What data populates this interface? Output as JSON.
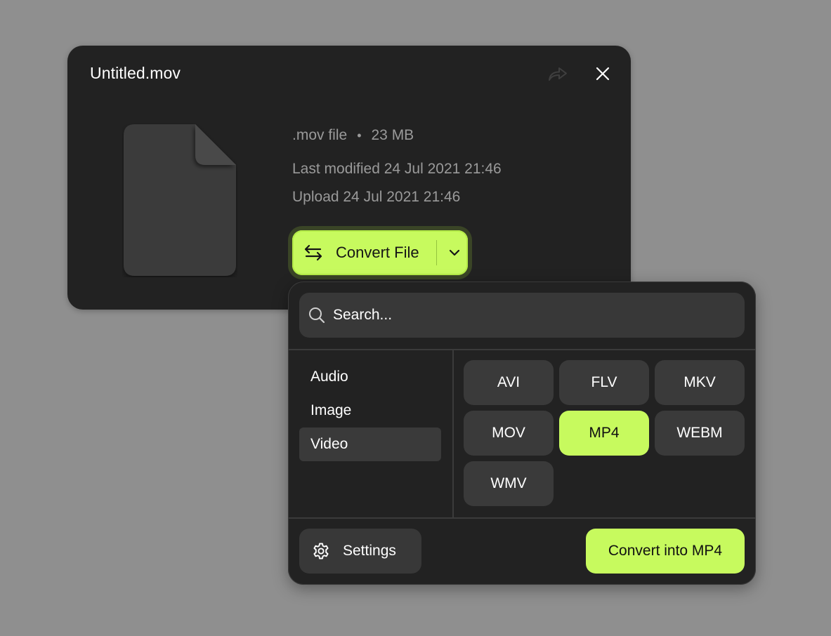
{
  "colors": {
    "background": "#8f8f8f",
    "card": "#222222",
    "accent": "#c7fa5e",
    "muted_text": "#9a9a9a",
    "chip": "#3a3a3a"
  },
  "file_card": {
    "title": "Untitled.mov",
    "share_icon": "share-forward-icon",
    "close_icon": "close-icon",
    "file_icon": "document-icon",
    "file_type": ".mov file",
    "separator": "•",
    "file_size": "23 MB",
    "last_modified": "Last modified 24 Jul 2021 21:46",
    "uploaded": "Upload 24 Jul 2021 21:46",
    "convert_button": {
      "label": "Convert File",
      "icon": "swap-arrows-icon",
      "dropdown_icon": "chevron-down-icon"
    }
  },
  "convert_panel": {
    "search": {
      "placeholder": "Search...",
      "value": "",
      "icon": "search-icon"
    },
    "categories": [
      {
        "label": "Audio",
        "active": false
      },
      {
        "label": "Image",
        "active": false
      },
      {
        "label": "Video",
        "active": true
      }
    ],
    "formats": [
      {
        "label": "AVI",
        "selected": false
      },
      {
        "label": "FLV",
        "selected": false
      },
      {
        "label": "MKV",
        "selected": false
      },
      {
        "label": "MOV",
        "selected": false
      },
      {
        "label": "MP4",
        "selected": true
      },
      {
        "label": "WEBM",
        "selected": false
      },
      {
        "label": "WMV",
        "selected": false
      }
    ],
    "settings_button": {
      "label": "Settings",
      "icon": "gear-icon"
    },
    "convert_into_button": {
      "label": "Convert into MP4"
    }
  }
}
